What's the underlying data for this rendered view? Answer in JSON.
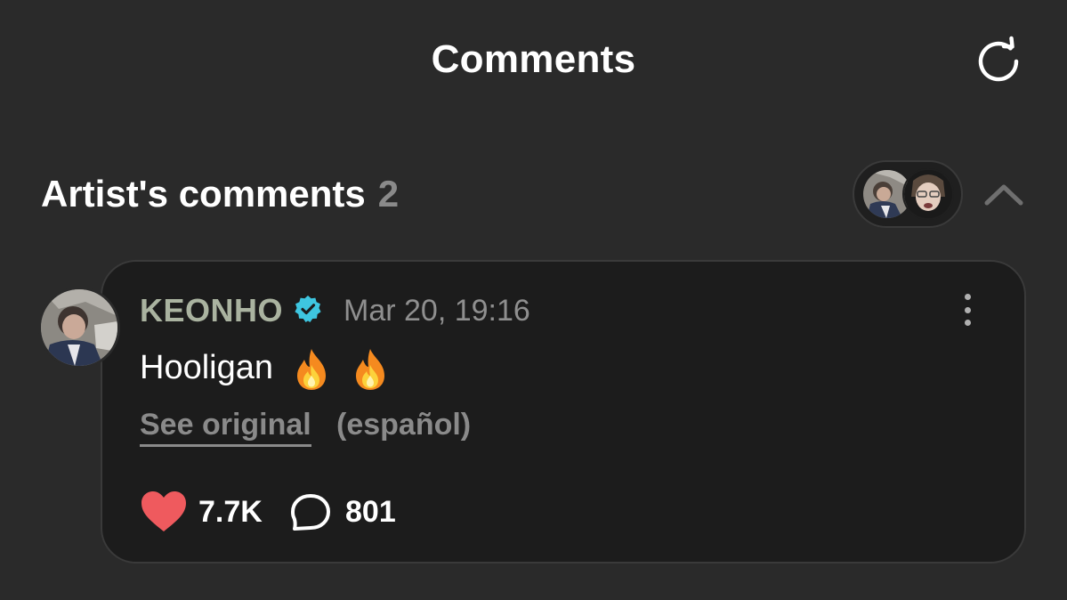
{
  "header": {
    "title": "Comments",
    "refresh_icon": "refresh-icon"
  },
  "artist_section": {
    "title": "Artist's comments",
    "count": "2",
    "collapse_icon": "chevron-up-icon"
  },
  "comment": {
    "author": "KEONHO",
    "verified_icon": "verified-badge-icon",
    "timestamp": "Mar 20, 19:16",
    "text": "Hooligan",
    "emojis": [
      "fire-emoji",
      "fire-emoji"
    ],
    "see_original": "See original",
    "original_language": "(español)",
    "likes": "7.7K",
    "replies": "801",
    "like_icon": "heart-icon",
    "reply_icon": "comment-bubble-icon",
    "more_icon": "more-vertical-icon"
  },
  "colors": {
    "background": "#2a2a2a",
    "card": "#1c1c1c",
    "author": "#aab3a0",
    "verified": "#3ec6e0",
    "heart": "#ef5a5e",
    "muted": "#8a8a8a"
  }
}
